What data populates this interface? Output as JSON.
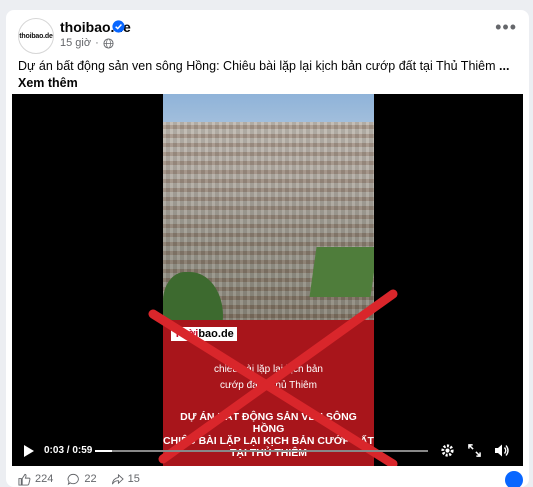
{
  "post": {
    "page_name": "thoibao.de",
    "avatar_text": "thoibao.de",
    "time": "15 giờ",
    "separator": "·",
    "caption": "Dự án bất động sản ven sông Hồng: Chiêu bài lặp lại kịch bản cướp đất tại Thủ Thiêm",
    "see_more": "... Xem thêm",
    "more_icon": "more-horizontal-icon"
  },
  "video": {
    "brand_tag_red": "Thời",
    "brand_tag_black": "bao.de",
    "subtitle_line1": "chiêu bài lặp lại kịch bản",
    "subtitle_line2": "cướp đất ở thủ Thiêm",
    "headline_line1": "DỰ ÁN BẤT ĐỘNG SẢN VEN SÔNG HỒNG",
    "headline_line2": "CHIÊU BÀI LẶP LẠI KỊCH BẢN CƯỚP ĐẤT",
    "headline_line3": "TẠI THỦ THIÊM",
    "time_display": "0:03 / 0:59",
    "progress": 0.05,
    "accent_red": "#d9262b"
  },
  "reactions": {
    "likes": "224",
    "comments": "22",
    "shares": "15"
  }
}
